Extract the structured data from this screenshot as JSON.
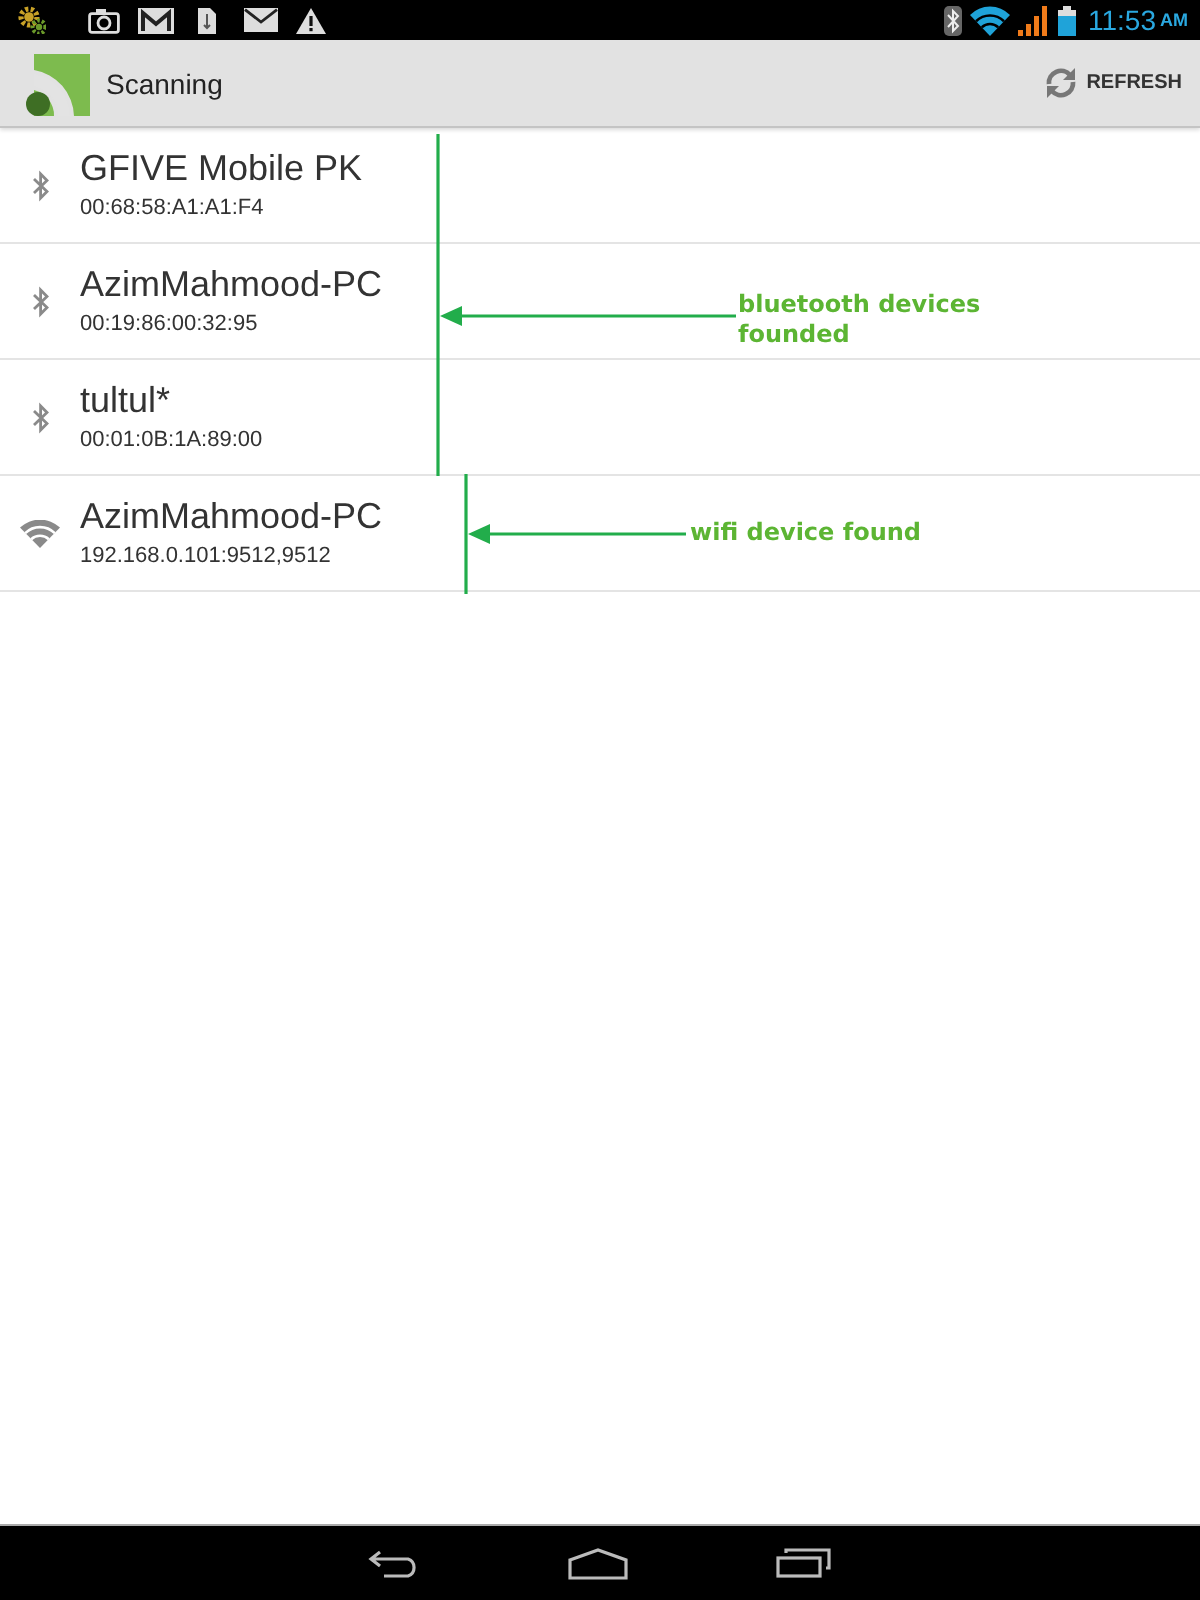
{
  "status_bar": {
    "time": "11:53",
    "meridiem": "AM"
  },
  "action_bar": {
    "title": "Scanning",
    "action": "REFRESH"
  },
  "devices": [
    {
      "kind": "bluetooth",
      "name": "GFIVE Mobile PK",
      "address": "00:68:58:A1:A1:F4"
    },
    {
      "kind": "bluetooth",
      "name": "AzimMahmood-PC",
      "address": "00:19:86:00:32:95"
    },
    {
      "kind": "bluetooth",
      "name": "tultul*",
      "address": "00:01:0B:1A:89:00"
    },
    {
      "kind": "wifi",
      "name": "AzimMahmood-PC",
      "address": "192.168.0.101:9512,9512"
    }
  ],
  "annotations": [
    {
      "text": "bluetooth devices founded"
    },
    {
      "text": "wifi device found"
    }
  ]
}
